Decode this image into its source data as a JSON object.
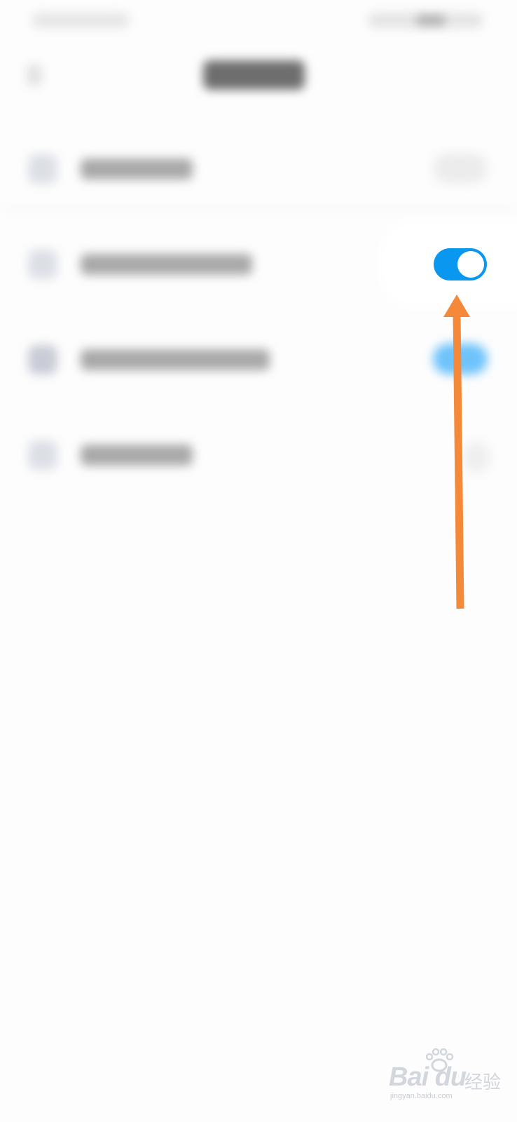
{
  "watermark": {
    "logo_text": "Bai du",
    "cn_text": "经验",
    "url": "jingyan.baidu.com"
  },
  "settings_rows": [
    {
      "toggle_state": "off"
    },
    {
      "toggle_state": "on"
    },
    {
      "toggle_state": "on"
    },
    {
      "toggle_state": "none"
    }
  ],
  "highlighted_toggle": {
    "state": "on"
  },
  "colors": {
    "toggle_on": "#0a97f0",
    "arrow": "#f5893a",
    "background": "#fdfdfd"
  },
  "icons": [
    "back-arrow-icon",
    "annotation-arrow-icon",
    "baidu-paw-icon"
  ]
}
